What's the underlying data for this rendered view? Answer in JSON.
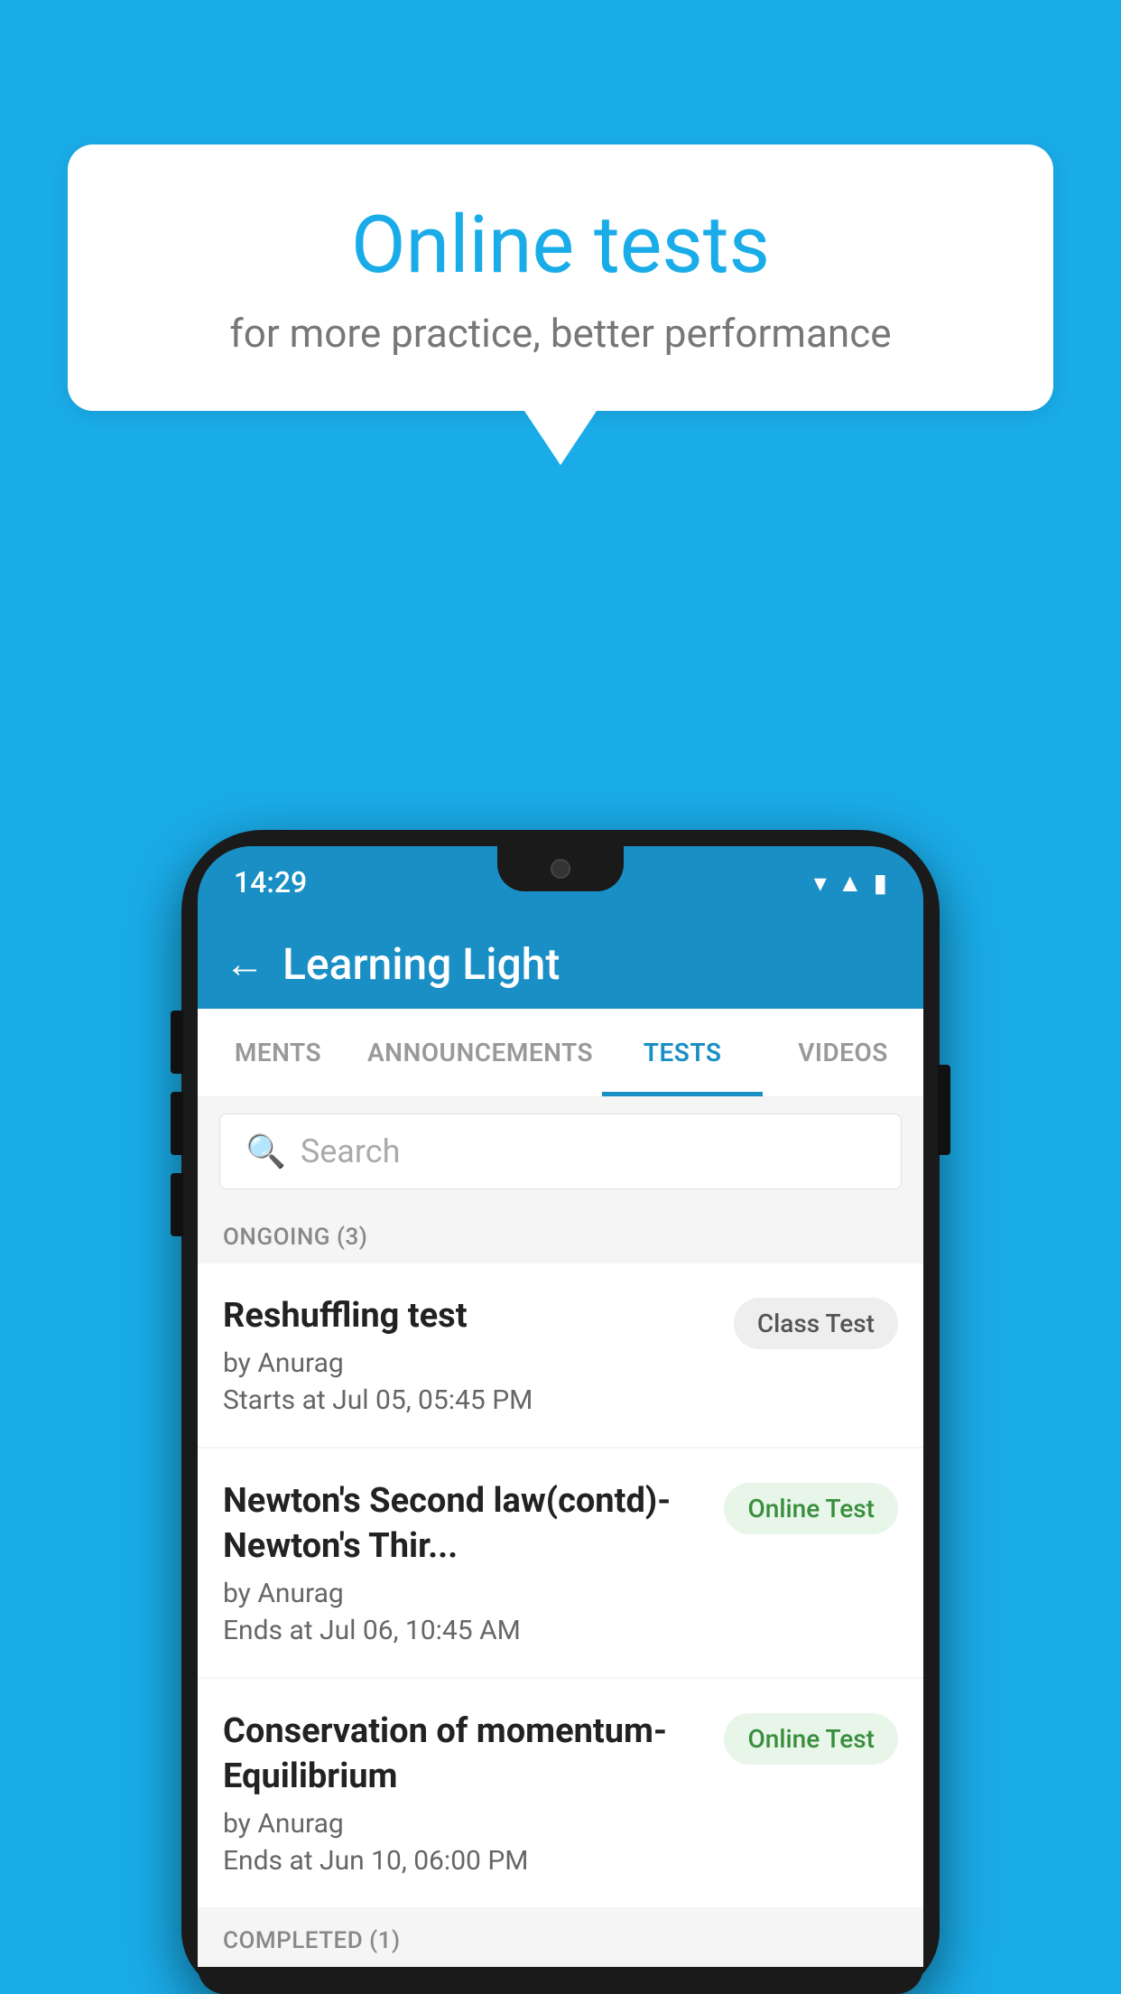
{
  "background": {
    "color": "#1AACE8"
  },
  "speech_bubble": {
    "title": "Online tests",
    "subtitle": "for more practice, better performance"
  },
  "phone": {
    "status_bar": {
      "time": "14:29",
      "signal_icon": "▲",
      "wifi_icon": "▼"
    },
    "header": {
      "back_label": "←",
      "title": "Learning Light"
    },
    "tabs": [
      {
        "label": "MENTS",
        "active": false
      },
      {
        "label": "ANNOUNCEMENTS",
        "active": false
      },
      {
        "label": "TESTS",
        "active": true
      },
      {
        "label": "VIDEOS",
        "active": false
      }
    ],
    "search": {
      "placeholder": "Search"
    },
    "sections": [
      {
        "header": "ONGOING (3)",
        "tests": [
          {
            "title": "Reshuffling test",
            "author": "by Anurag",
            "date": "Starts at  Jul 05, 05:45 PM",
            "badge": "Class Test",
            "badge_type": "class"
          },
          {
            "title": "Newton's Second law(contd)-Newton's Thir...",
            "author": "by Anurag",
            "date": "Ends at  Jul 06, 10:45 AM",
            "badge": "Online Test",
            "badge_type": "online"
          },
          {
            "title": "Conservation of momentum-Equilibrium",
            "author": "by Anurag",
            "date": "Ends at  Jun 10, 06:00 PM",
            "badge": "Online Test",
            "badge_type": "online"
          }
        ]
      },
      {
        "header": "COMPLETED (1)",
        "tests": []
      }
    ]
  }
}
